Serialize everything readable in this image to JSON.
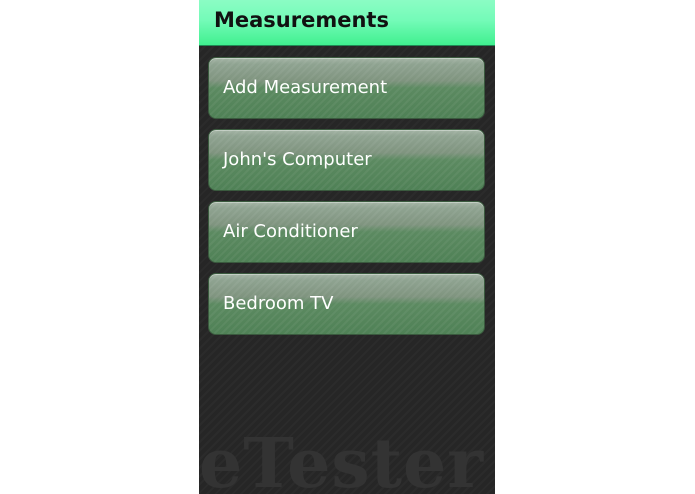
{
  "app": {
    "title": "Measurements",
    "watermark": "eTester"
  },
  "list": {
    "items": [
      {
        "label": "Add Measurement"
      },
      {
        "label": "John's Computer"
      },
      {
        "label": "Air Conditioner"
      },
      {
        "label": "Bedroom TV"
      }
    ]
  },
  "colors": {
    "title_bar": "#74fbb8",
    "background": "#262626",
    "item_green": "#4f8156",
    "item_text": "#ffffff"
  }
}
